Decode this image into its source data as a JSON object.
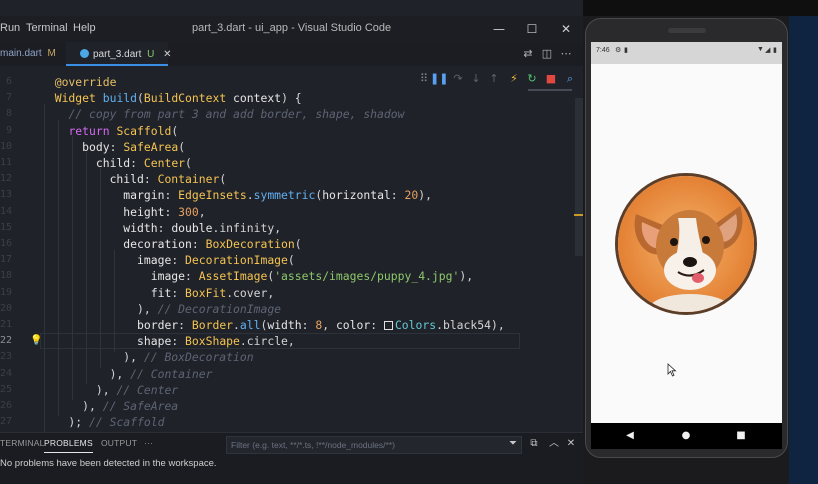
{
  "window": {
    "title": "part_3.dart - ui_app - Visual Studio Code",
    "menu": [
      "Run",
      "Terminal",
      "Help"
    ]
  },
  "tabs": [
    {
      "label": "main.dart",
      "badge": "M"
    },
    {
      "label": "part_3.dart",
      "badge": "U"
    }
  ],
  "editor": {
    "active_line": 22,
    "lines": [
      {
        "n": 6,
        "code": "  @override"
      },
      {
        "n": 7,
        "code": "  Widget build(BuildContext context) {"
      },
      {
        "n": 8,
        "code": "    // copy from part 3 and add border, shape, shadow"
      },
      {
        "n": 9,
        "code": "    return Scaffold("
      },
      {
        "n": 10,
        "code": "      body: SafeArea("
      },
      {
        "n": 11,
        "code": "        child: Center("
      },
      {
        "n": 12,
        "code": "          child: Container("
      },
      {
        "n": 13,
        "code": "            margin: EdgeInsets.symmetric(horizontal: 20),"
      },
      {
        "n": 14,
        "code": "            height: 300,"
      },
      {
        "n": 15,
        "code": "            width: double.infinity,"
      },
      {
        "n": 16,
        "code": "            decoration: BoxDecoration("
      },
      {
        "n": 17,
        "code": "              image: DecorationImage("
      },
      {
        "n": 18,
        "code": "                image: AssetImage('assets/images/puppy_4.jpg'),"
      },
      {
        "n": 19,
        "code": "                fit: BoxFit.cover,"
      },
      {
        "n": 20,
        "code": "              ), // DecorationImage"
      },
      {
        "n": 21,
        "code": "              border: Border.all(width: 8, color: Colors.black54),"
      },
      {
        "n": 22,
        "code": "              shape: BoxShape.circle,"
      },
      {
        "n": 23,
        "code": "            ), // BoxDecoration"
      },
      {
        "n": 24,
        "code": "          ), // Container"
      },
      {
        "n": 25,
        "code": "        ), // Center"
      },
      {
        "n": 26,
        "code": "      ), // SafeArea"
      },
      {
        "n": 27,
        "code": "    ); // Scaffold"
      }
    ]
  },
  "panel": {
    "tabs": [
      "TERMINAL",
      "PROBLEMS",
      "OUTPUT",
      "···"
    ],
    "active_tab": "PROBLEMS",
    "filter_placeholder": "Filter (e.g. text, **/*.ts, !**/node_modules/**)",
    "message": "No problems have been detected in the workspace."
  },
  "emulator": {
    "status_time": "7:46",
    "image_subject": "corgi puppy"
  },
  "colors": {
    "accent": "#3a8ee6",
    "editor_bg": "#1f2229",
    "border_ring": "#5b3d28"
  }
}
